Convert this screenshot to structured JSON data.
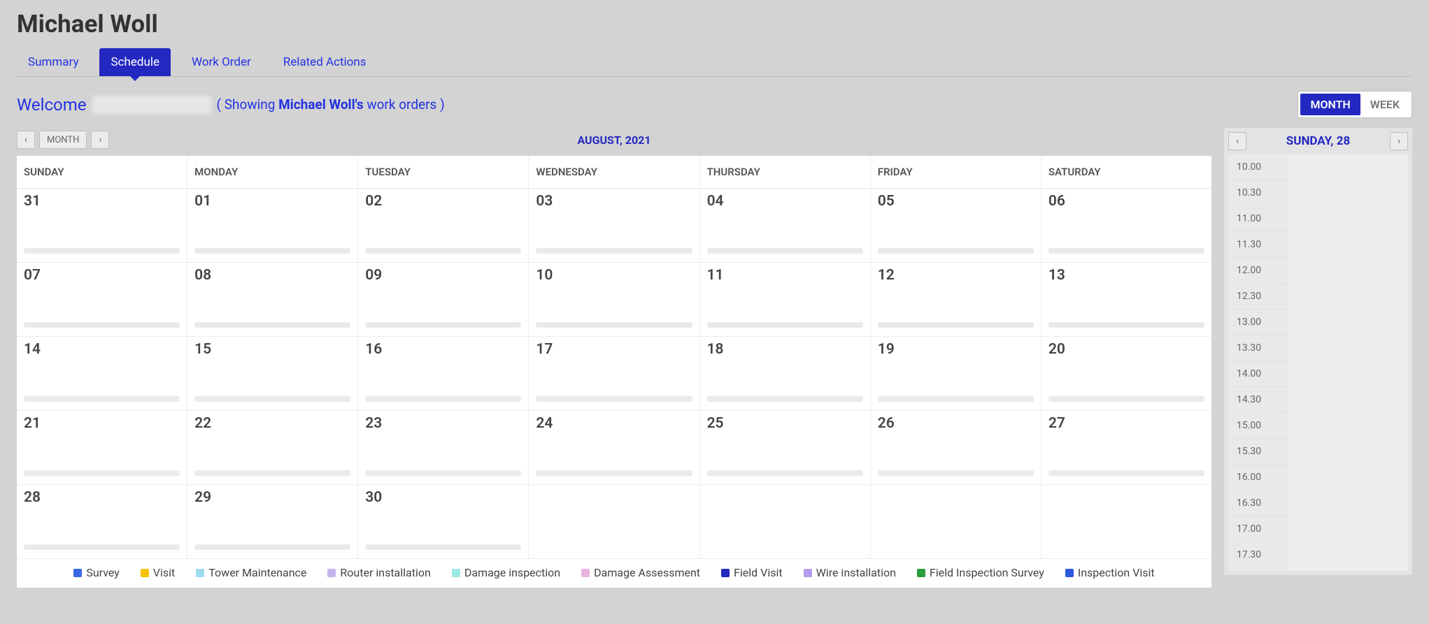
{
  "page_title": "Michael Woll",
  "tabs": [
    {
      "label": "Summary",
      "active": false
    },
    {
      "label": "Schedule",
      "active": true
    },
    {
      "label": "Work Order",
      "active": false
    },
    {
      "label": "Related Actions",
      "active": false
    }
  ],
  "welcome": {
    "label": "Welcome",
    "showing_prefix": "( Showing ",
    "showing_name": "Michael Woll's",
    "showing_suffix": " work orders )"
  },
  "view_toggle": {
    "month": "MONTH",
    "week": "WEEK",
    "active": "MONTH"
  },
  "month_nav": {
    "today_btn": "MONTH",
    "title": "AUGUST, 2021"
  },
  "calendar": {
    "day_headers": [
      "SUNDAY",
      "MONDAY",
      "TUESDAY",
      "WEDNESDAY",
      "THURSDAY",
      "FRIDAY",
      "SATURDAY"
    ],
    "weeks": [
      [
        "31",
        "01",
        "02",
        "03",
        "04",
        "05",
        "06"
      ],
      [
        "07",
        "08",
        "09",
        "10",
        "11",
        "12",
        "13"
      ],
      [
        "14",
        "15",
        "16",
        "17",
        "18",
        "19",
        "20"
      ],
      [
        "21",
        "22",
        "23",
        "24",
        "25",
        "26",
        "27"
      ],
      [
        "28",
        "29",
        "30",
        "",
        "",
        "",
        ""
      ]
    ],
    "legend": [
      {
        "label": "Survey",
        "color": "#3a66e5"
      },
      {
        "label": "Visit",
        "color": "#f6c106"
      },
      {
        "label": "Tower Maintenance",
        "color": "#9ddcf3"
      },
      {
        "label": "Router installation",
        "color": "#c6b4ed"
      },
      {
        "label": "Damage inspection",
        "color": "#9de8e2"
      },
      {
        "label": "Damage Assessment",
        "color": "#e7b4e0"
      },
      {
        "label": "Field Visit",
        "color": "#2328c1"
      },
      {
        "label": "Wire installation",
        "color": "#b49cec"
      },
      {
        "label": "Field Inspection Survey",
        "color": "#2a9d3f"
      },
      {
        "label": "Inspection Visit",
        "color": "#2d59e0"
      }
    ]
  },
  "day_pane": {
    "title": "SUNDAY, 28",
    "slots": [
      "10.00",
      "10.30",
      "11.00",
      "11.30",
      "12.00",
      "12.30",
      "13.00",
      "13.30",
      "14.00",
      "14.30",
      "15.00",
      "15.30",
      "16.00",
      "16.30",
      "17.00",
      "17.30"
    ]
  }
}
